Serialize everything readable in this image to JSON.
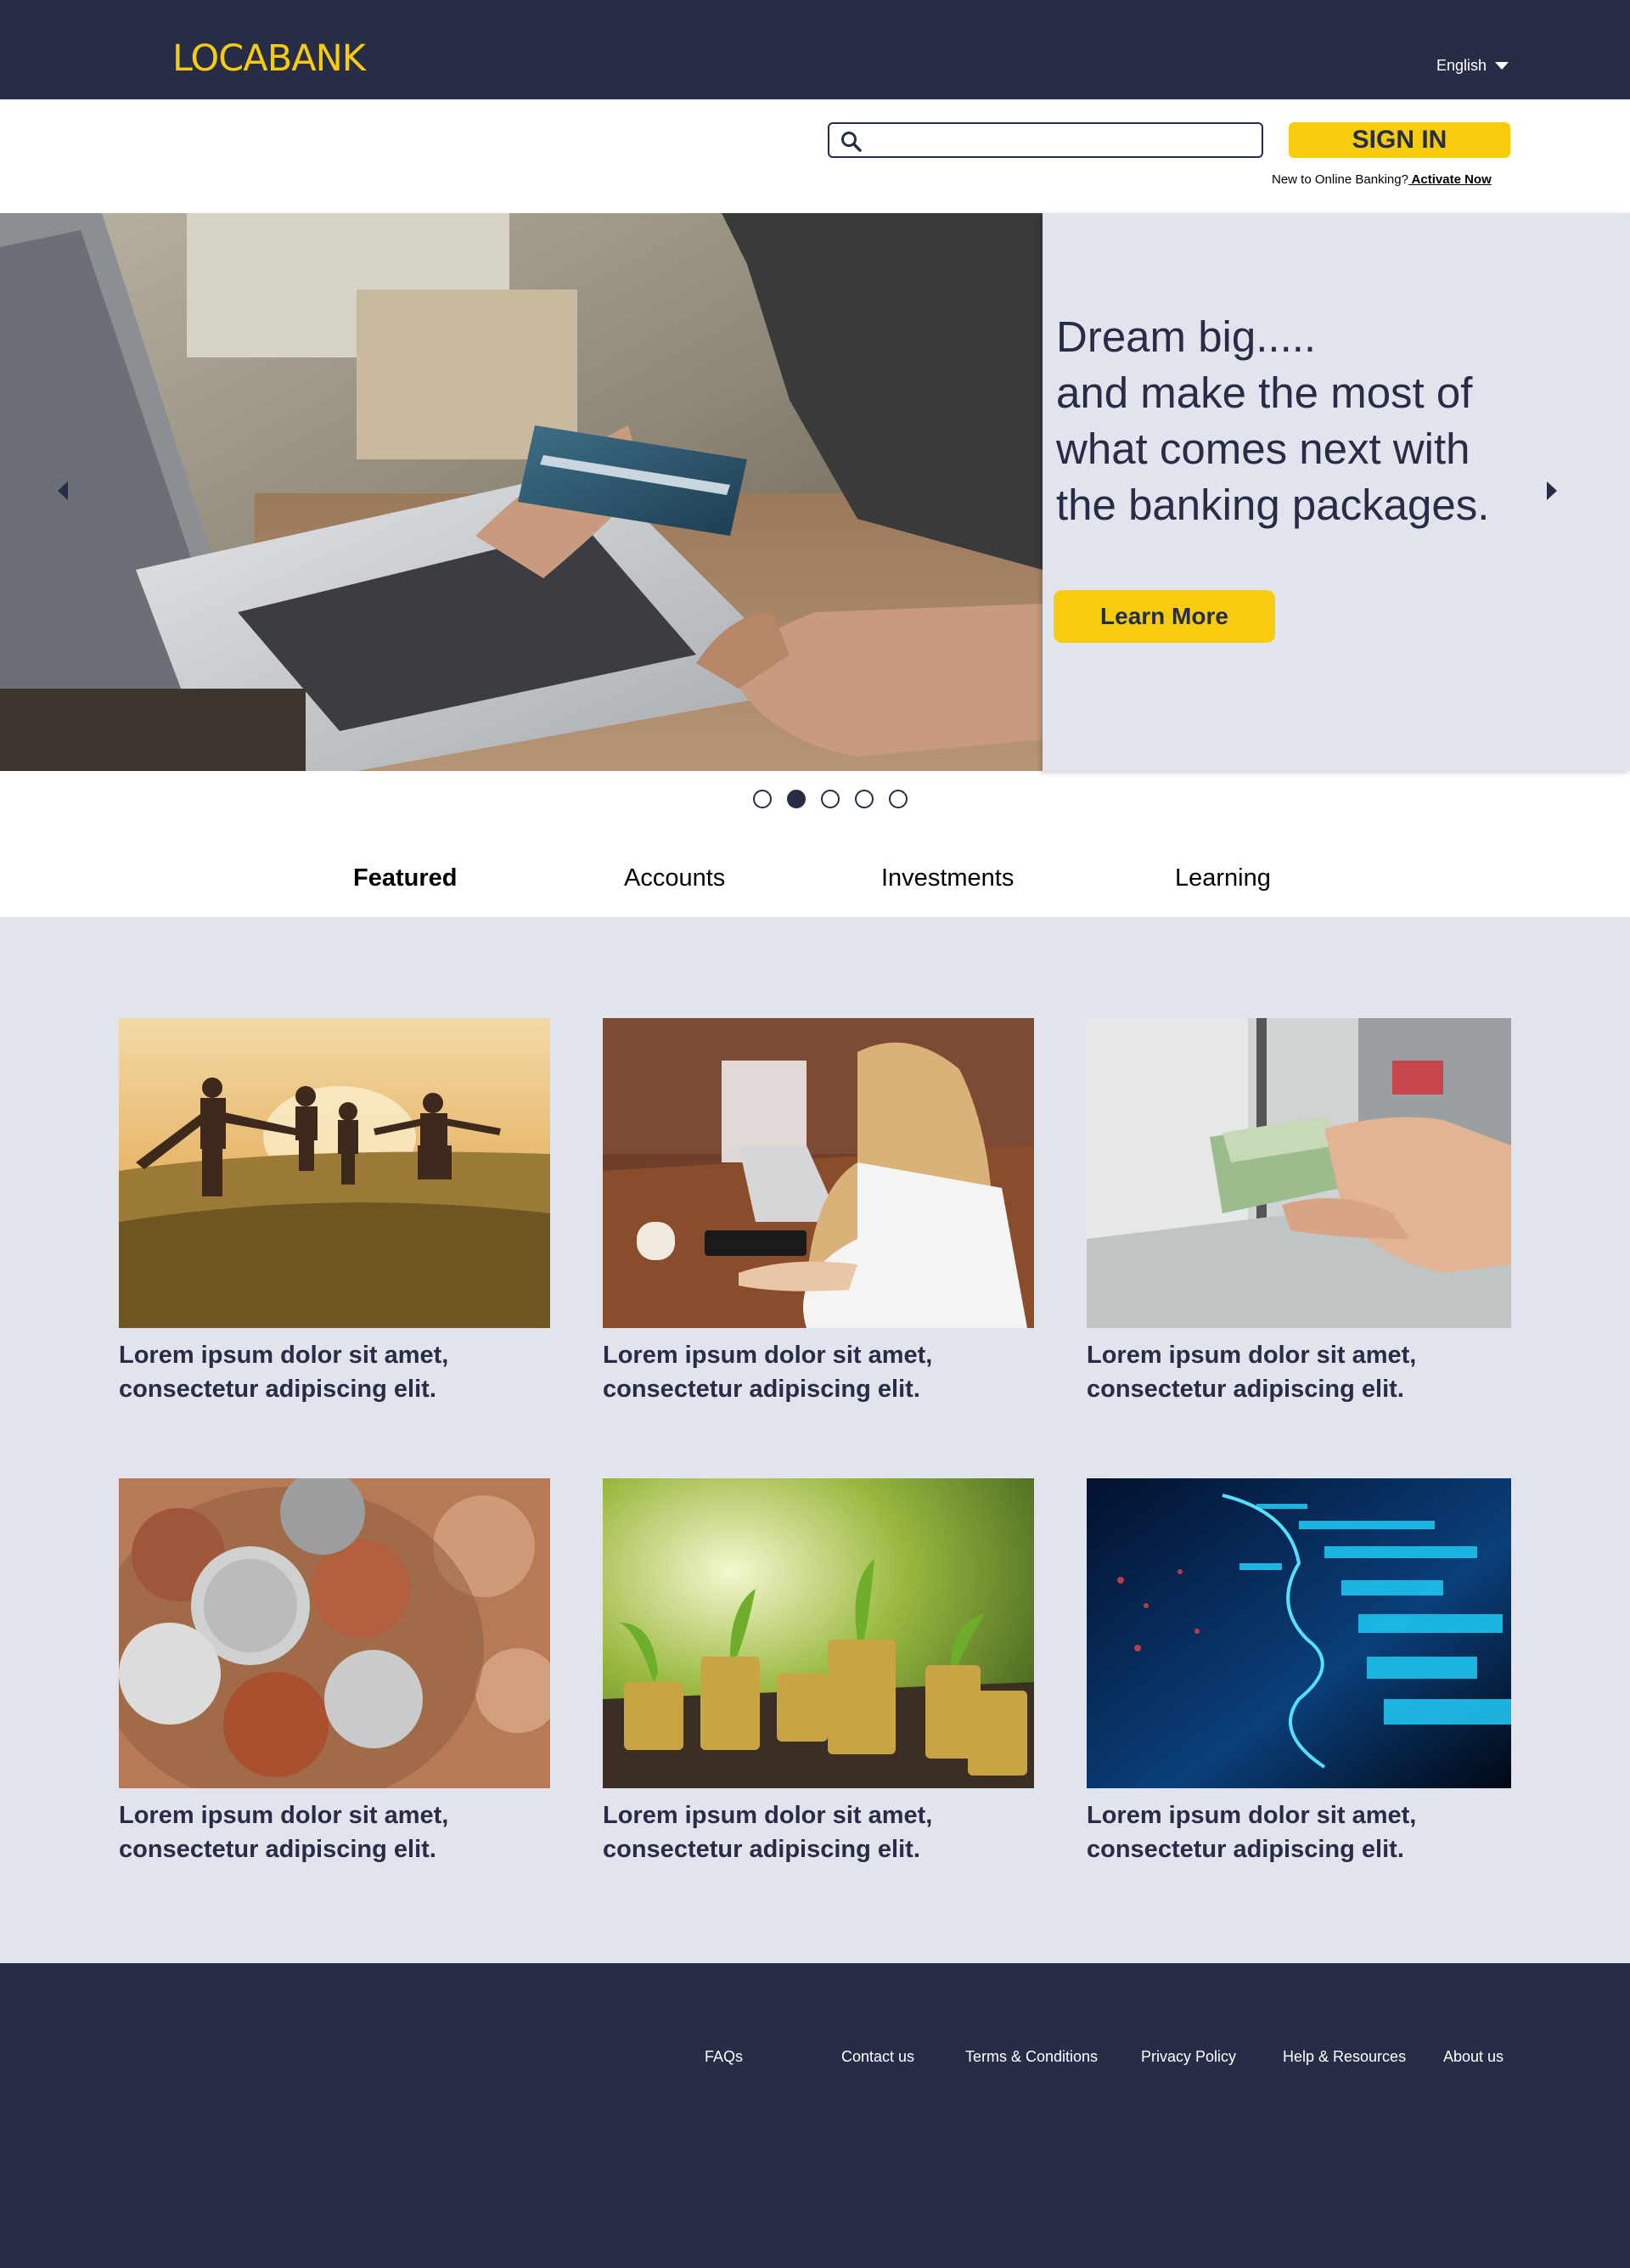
{
  "header": {
    "logo": "LOCABANK",
    "language": "English"
  },
  "search": {
    "placeholder": ""
  },
  "auth": {
    "sign_in_label": "SIGN IN",
    "new_user_text": "New to Online Banking?",
    "activate_label": " Activate Now"
  },
  "hero": {
    "line1": "Dream big.....",
    "line2": "and make the most of",
    "line3": "what comes next with",
    "line4": "the banking packages.",
    "cta_label": "Learn More",
    "active_slide": 2,
    "slide_count": 5
  },
  "tabs": [
    {
      "label": "Featured",
      "active": true
    },
    {
      "label": "Accounts",
      "active": false
    },
    {
      "label": "Investments",
      "active": false
    },
    {
      "label": "Learning",
      "active": false
    }
  ],
  "cards": [
    {
      "line1": "Lorem ipsum dolor sit amet,",
      "line2": "consectetur adipiscing elit."
    },
    {
      "line1": "Lorem ipsum dolor sit amet,",
      "line2": "consectetur adipiscing elit."
    },
    {
      "line1": "Lorem ipsum dolor sit amet,",
      "line2": "consectetur adipiscing elit."
    },
    {
      "line1": "Lorem ipsum dolor sit amet,",
      "line2": "consectetur adipiscing elit."
    },
    {
      "line1": "Lorem ipsum dolor sit amet,",
      "line2": "consectetur adipiscing elit."
    },
    {
      "line1": "Lorem ipsum dolor sit amet,",
      "line2": "consectetur adipiscing elit."
    }
  ],
  "footer": {
    "links": [
      "FAQs",
      "Contact us",
      "Terms & Conditions",
      "Privacy Policy",
      "Help & Resources",
      "About us"
    ]
  },
  "colors": {
    "navy": "#272d47",
    "yellow": "#f7cc0e",
    "panel": "#e1e4ed"
  }
}
